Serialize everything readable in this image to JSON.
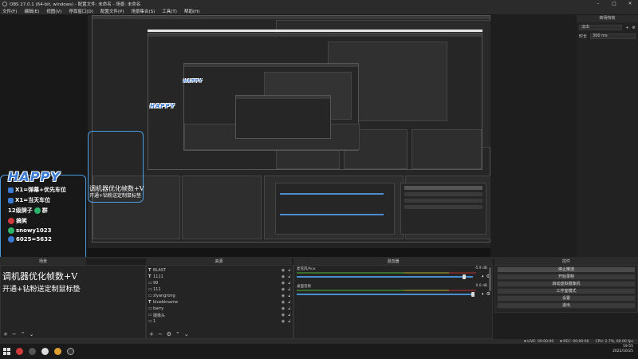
{
  "window": {
    "title": "OBS 27.0.1 (64-bit, windows) - 配置文件: 未命名 - 场景: 未命名",
    "minimize": "–",
    "maximize": "□",
    "close": "✕"
  },
  "menu": [
    "文件(F)",
    "编辑(E)",
    "视图(V)",
    "停靠窗口(D)",
    "配置文件(P)",
    "场景集合(S)",
    "工具(T)",
    "帮助(H)"
  ],
  "overlay": {
    "brand": "HAPPY",
    "rules": [
      "X1=弹幕+优先车位",
      "X1=当天车位",
      "12级牌子",
      "群",
      "搞笑",
      "snowy1023",
      "6025=5632"
    ]
  },
  "right_panel": {
    "title": "转场特效",
    "transition": "淡出",
    "duration_label": "时长",
    "duration_value": "300 ms"
  },
  "docks": {
    "scenes_title": "场景",
    "sources_title": "来源",
    "mixer_title": "混音器",
    "controls_title": "控件"
  },
  "scene_text": {
    "line1": "调机器优化帧数+V",
    "line2": "开通+钻粉送定制鼠标垫"
  },
  "sources": [
    {
      "type": "T",
      "name": "BLAST"
    },
    {
      "type": "T",
      "name": "1111"
    },
    {
      "type": "▭",
      "name": "99"
    },
    {
      "type": "▭",
      "name": "111"
    },
    {
      "type": "▭",
      "name": "zlyangrong"
    },
    {
      "type": "T",
      "name": "bluebkname"
    },
    {
      "type": "▭",
      "name": "barry"
    },
    {
      "type": "▭",
      "name": "摄像头"
    },
    {
      "type": "▭",
      "name": "1"
    }
  ],
  "mixer": [
    {
      "label": "麦克风/Aux",
      "db": "-5.9 dB",
      "level": 0.95
    },
    {
      "label": "桌面音频",
      "db": "0.0 dB",
      "level": 1.0
    }
  ],
  "controls": [
    "停止推流",
    "开始录制",
    "启动虚拟摄像机",
    "工作室模式",
    "设置",
    "退出"
  ],
  "status": {
    "live": "LIVE: 00:00:00",
    "rec": "REC: 00:00:00",
    "cpu": "CPU: 2.7%, 60.00 fps"
  },
  "tray": {
    "time": "19:55",
    "date": "2022/10/25"
  },
  "colors": {
    "accent": "#4a8fd0",
    "brand_blue": "#3a7bd5",
    "red": "#d03a3a",
    "green": "#2fb56a"
  }
}
